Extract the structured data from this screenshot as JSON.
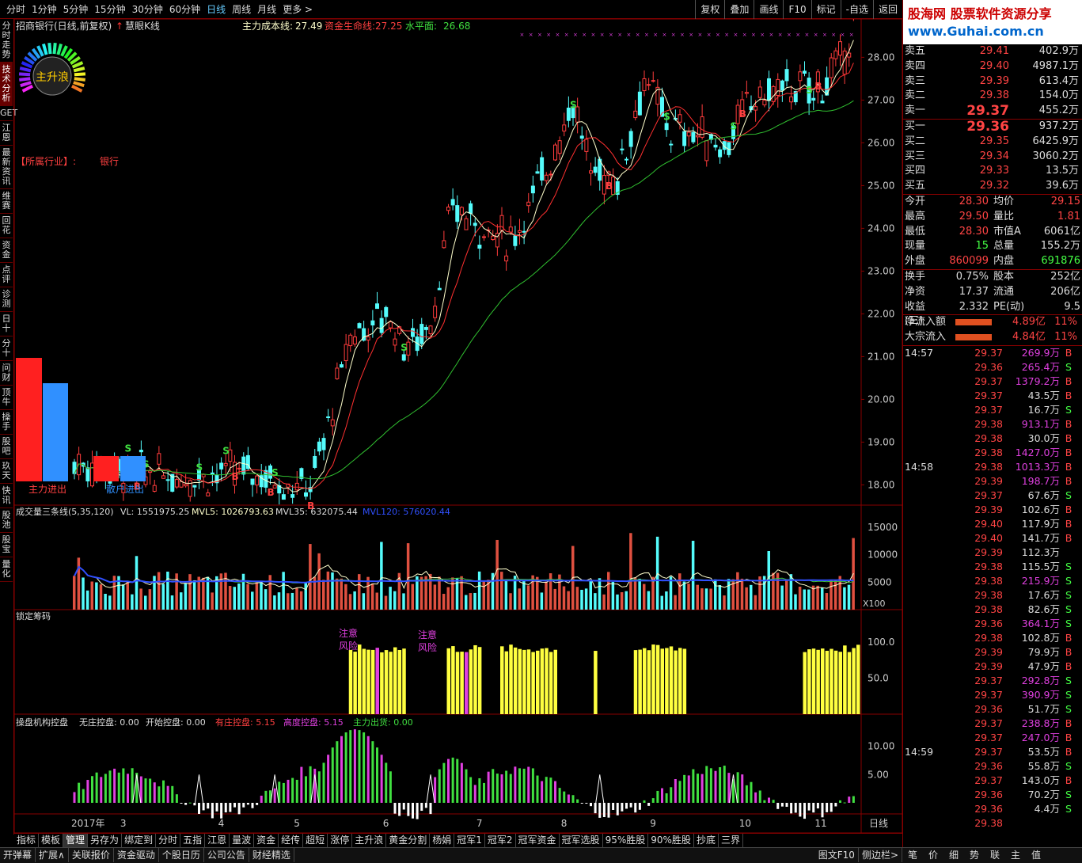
{
  "topbar": {
    "periods": [
      "分时",
      "1分钟",
      "5分钟",
      "15分钟",
      "30分钟",
      "60分钟",
      "日线",
      "周线",
      "月线",
      "更多 >"
    ],
    "active": "日线",
    "tools": [
      "复权",
      "叠加",
      "画线",
      "F10",
      "标记",
      "-自选",
      "返回"
    ]
  },
  "leftnav": [
    "分时走势",
    "技术分析",
    "GET",
    "江恩",
    "最新资讯",
    "维赛",
    "回花",
    "资金",
    "点评",
    "诊测",
    "日十",
    "分十",
    "问财",
    "顶牛",
    "操手",
    "股吧",
    "玖天",
    "快讯",
    "股池",
    "股宝",
    "量化"
  ],
  "main": {
    "title": "招商银行(日线,前复权)",
    "indicator": "慧眼K线",
    "cost_label": "主力成本线:",
    "cost": "27.49",
    "life_label": "资金生命线:",
    "life": "27.25",
    "water_label": "水平面:",
    "water": "26.68",
    "industry_label": "【所属行业】:",
    "industry": "银行",
    "gauge_text": "主升浪",
    "bar_label1": "主力进出",
    "bar_label2": "散户进出",
    "prices": [
      "28.00",
      "27.00",
      "26.00",
      "25.00",
      "24.00",
      "23.00",
      "22.00",
      "21.00",
      "20.00",
      "19.00",
      "18.00"
    ]
  },
  "vol": {
    "title": "成交量三条线(5,35,120)",
    "vl": "VL: 1551975.25",
    "m5": "MVL5: 1026793.63",
    "m35": "MVL35: 632075.44",
    "m120": "MVL120: 576020.44",
    "ticks": [
      "15000",
      "10000",
      "5000"
    ],
    "unit": "X100"
  },
  "lock": {
    "title": "锁定筹码",
    "ticks": [
      "100.0",
      "50.0"
    ],
    "note1": "注意",
    "note2": "风险"
  },
  "ctrl": {
    "title": "操盘机构控盘",
    "a": "无庄控盘: 0.00",
    "b": "开始控盘: 0.00",
    "c": "有庄控盘: 5.15",
    "d": "高度控盘: 5.15",
    "e": "主力出货: 0.00",
    "ticks": [
      "10.00",
      "5.00"
    ]
  },
  "dates": [
    "2017年",
    "3",
    "4",
    "5",
    "6",
    "7",
    "8",
    "9",
    "10",
    "11"
  ],
  "period_label": "日线",
  "bottab": [
    "指标",
    "模板",
    "管理",
    "另存为",
    "绑定到",
    "分时",
    "五指",
    "江恩",
    "量波",
    "资金",
    "经传",
    "超短",
    "涨停",
    "主升浪",
    "黄金分割",
    "杨娟",
    "冠军1",
    "冠军2",
    "冠军资金",
    "冠军选股",
    "95%胜股",
    "90%胜股",
    "抄底",
    "三界"
  ],
  "statbar": [
    "开弹幕",
    "扩展∧",
    "关联报价",
    "资金驱动",
    "个股日历",
    "公司公告",
    "财经精选"
  ],
  "statright": [
    "图文F10",
    "侧边栏>"
  ],
  "rbot": [
    "笔",
    "价",
    "细",
    "势",
    "联",
    "主",
    "值"
  ],
  "logo": {
    "l1": "股海网 股票软件资源分享",
    "l2": "www.Guhai.com.cn"
  },
  "asks": [
    [
      "卖五",
      "29.41",
      "402.9万"
    ],
    [
      "卖四",
      "29.40",
      "4987.1万"
    ],
    [
      "卖三",
      "29.39",
      "613.4万"
    ],
    [
      "卖二",
      "29.38",
      "154.0万"
    ],
    [
      "卖一",
      "29.37",
      "455.2万"
    ]
  ],
  "bids": [
    [
      "买一",
      "29.36",
      "937.2万"
    ],
    [
      "买二",
      "29.35",
      "6425.9万"
    ],
    [
      "买三",
      "29.34",
      "3060.2万"
    ],
    [
      "买四",
      "29.33",
      "13.5万"
    ],
    [
      "买五",
      "29.32",
      "39.6万"
    ]
  ],
  "stats": [
    [
      "今开",
      "28.30",
      "均价",
      "29.15"
    ],
    [
      "最高",
      "29.50",
      "量比",
      "1.81"
    ],
    [
      "最低",
      "28.30",
      "市值A",
      "6061亿"
    ],
    [
      "现量",
      "15",
      "总量",
      "155.2万"
    ],
    [
      "外盘",
      "860099",
      "内盘",
      "691876"
    ],
    [
      "换手",
      "0.75%",
      "股本",
      "252亿"
    ],
    [
      "净资",
      "17.37",
      "流通",
      "206亿"
    ],
    [
      "收益(三)",
      "2.332",
      "PE(动)",
      "9.5"
    ]
  ],
  "flows": [
    [
      "净流入额",
      "4.89亿",
      "11%"
    ],
    [
      "大宗流入",
      "4.84亿",
      "11%"
    ]
  ],
  "ticks": [
    [
      "14:57",
      "29.37",
      "269.9万",
      "B"
    ],
    [
      "",
      "29.36",
      "265.4万",
      "S"
    ],
    [
      "",
      "29.37",
      "1379.2万",
      "B"
    ],
    [
      "",
      "29.37",
      "43.5万",
      "B"
    ],
    [
      "",
      "29.37",
      "16.7万",
      "S"
    ],
    [
      "",
      "29.38",
      "913.1万",
      "B"
    ],
    [
      "",
      "29.38",
      "30.0万",
      "B"
    ],
    [
      "",
      "29.38",
      "1427.0万",
      "B"
    ],
    [
      "14:58",
      "29.38",
      "1013.3万",
      "B"
    ],
    [
      "",
      "29.39",
      "198.7万",
      "B"
    ],
    [
      "",
      "29.37",
      "67.6万",
      "S"
    ],
    [
      "",
      "29.39",
      "102.6万",
      "B"
    ],
    [
      "",
      "29.40",
      "117.9万",
      "B"
    ],
    [
      "",
      "29.40",
      "141.7万",
      "B"
    ],
    [
      "",
      "29.39",
      "112.3万",
      ""
    ],
    [
      "",
      "29.38",
      "115.5万",
      "S"
    ],
    [
      "",
      "29.38",
      "215.9万",
      "S"
    ],
    [
      "",
      "29.38",
      "17.6万",
      "S"
    ],
    [
      "",
      "29.38",
      "82.6万",
      "S"
    ],
    [
      "",
      "29.36",
      "364.1万",
      "S"
    ],
    [
      "",
      "29.38",
      "102.8万",
      "B"
    ],
    [
      "",
      "29.39",
      "79.9万",
      "B"
    ],
    [
      "",
      "29.39",
      "47.9万",
      "B"
    ],
    [
      "",
      "29.37",
      "292.8万",
      "S"
    ],
    [
      "",
      "29.37",
      "390.9万",
      "S"
    ],
    [
      "",
      "29.36",
      "51.7万",
      "S"
    ],
    [
      "",
      "29.37",
      "238.8万",
      "B"
    ],
    [
      "",
      "29.37",
      "247.0万",
      "B"
    ],
    [
      "14:59",
      "29.37",
      "53.5万",
      "B"
    ],
    [
      "",
      "29.36",
      "55.8万",
      "S"
    ],
    [
      "",
      "29.37",
      "143.0万",
      "B"
    ],
    [
      "",
      "29.36",
      "70.2万",
      "S"
    ],
    [
      "",
      "29.36",
      "4.4万",
      "S"
    ],
    [
      "",
      "29.38",
      "",
      ""
    ]
  ],
  "colors": {
    "up": "#ff3c3c",
    "down": "#54fcfc",
    "ma1": "#ffffcc",
    "ma2": "#ff3030",
    "ma3": "#30c030",
    "yellow": "#ffff40",
    "magenta": "#e040e0",
    "green": "#40e040"
  }
}
